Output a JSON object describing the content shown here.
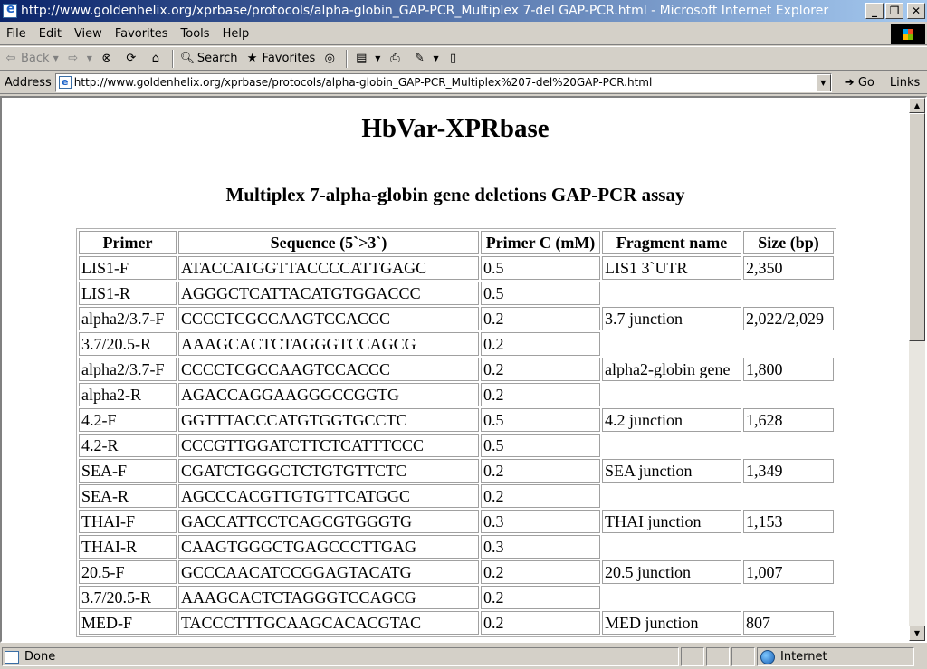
{
  "window": {
    "title": "http://www.goldenhelix.org/xprbase/protocols/alpha-globin_GAP-PCR_Multiplex 7-del GAP-PCR.html - Microsoft Internet Explorer",
    "minimize": "_",
    "maximize": "❐",
    "close": "✕"
  },
  "menu": {
    "items": [
      "File",
      "Edit",
      "View",
      "Favorites",
      "Tools",
      "Help"
    ]
  },
  "toolbar": {
    "back": "Back",
    "search": "Search",
    "favorites": "Favorites"
  },
  "address": {
    "label": "Address",
    "url": "http://www.goldenhelix.org/xprbase/protocols/alpha-globin_GAP-PCR_Multiplex%207-del%20GAP-PCR.html",
    "go": "Go",
    "links": "Links"
  },
  "page": {
    "site_title": "HbVar-XPRbase",
    "assay_title": "Multiplex 7-alpha-globin gene deletions GAP-PCR assay",
    "table": {
      "headers": [
        "Primer",
        "Sequence (5`>3`)",
        "Primer C (mM)",
        "Fragment name",
        "Size (bp)"
      ],
      "rows": [
        [
          "LIS1-F",
          "ATACCATGGTTACCCCATTGAGC",
          "0.5",
          "LIS1 3`UTR",
          "2,350"
        ],
        [
          "LIS1-R",
          "AGGGCTCATTACATGTGGACCC",
          "0.5",
          "",
          ""
        ],
        [
          "alpha2/3.7-F",
          "CCCCTCGCCAAGTCCACCC",
          "0.2",
          "3.7 junction",
          "2,022/2,029"
        ],
        [
          "3.7/20.5-R",
          "AAAGCACTCTAGGGTCCAGCG",
          "0.2",
          "",
          ""
        ],
        [
          "alpha2/3.7-F",
          "CCCCTCGCCAAGTCCACCC",
          "0.2",
          "alpha2-globin gene",
          "1,800"
        ],
        [
          "alpha2-R",
          "AGACCAGGAAGGGCCGGTG",
          "0.2",
          "",
          ""
        ],
        [
          "4.2-F",
          "GGTTTACCCATGTGGTGCCTC",
          "0.5",
          "4.2 junction",
          "1,628"
        ],
        [
          "4.2-R",
          "CCCGTTGGATCTTCTCATTTCCC",
          "0.5",
          "",
          ""
        ],
        [
          "SEA-F",
          "CGATCTGGGCTCTGTGTTCTC",
          "0.2",
          "SEA junction",
          "1,349"
        ],
        [
          "SEA-R",
          "AGCCCACGTTGTGTTCATGGC",
          "0.2",
          "",
          ""
        ],
        [
          "THAI-F",
          "GACCATTCCTCAGCGTGGGTG",
          "0.3",
          "THAI junction",
          "1,153"
        ],
        [
          "THAI-R",
          "CAAGTGGGCTGAGCCCTTGAG",
          "0.3",
          "",
          ""
        ],
        [
          "20.5-F",
          "GCCCAACATCCGGAGTACATG",
          "0.2",
          "20.5 junction",
          "1,007"
        ],
        [
          "3.7/20.5-R",
          "AAAGCACTCTAGGGTCCAGCG",
          "0.2",
          "",
          ""
        ],
        [
          "MED-F",
          "TACCCTTTGCAAGCACACGTAC",
          "0.2",
          "MED junction",
          "807"
        ]
      ]
    }
  },
  "status": {
    "text": "Done",
    "zone": "Internet"
  }
}
